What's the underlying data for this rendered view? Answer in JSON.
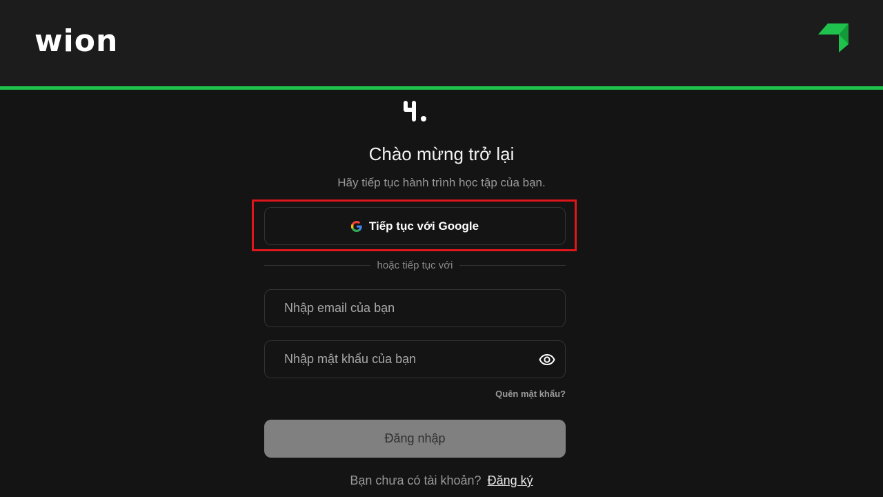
{
  "header": {
    "brand_name": "wion",
    "corner_icon": "green-arrow-icon",
    "accent_color": "#1fc24c"
  },
  "login": {
    "app_icon": "app-logo-icon",
    "title": "Chào mừng trở lại",
    "subtitle": "Hãy tiếp tục hành trình học tập của bạn.",
    "google_button_label": "Tiếp tục với Google",
    "divider_text": "hoặc tiếp tục với",
    "email_placeholder": "Nhập email của bạn",
    "email_value": "",
    "password_placeholder": "Nhập mật khẩu của bạn",
    "password_value": "",
    "forgot_password_label": "Quên mật khẩu?",
    "login_button_label": "Đăng nhập",
    "signup_prompt": "Bạn chưa có tài khoản?",
    "signup_link_label": "Đăng ký"
  },
  "highlight_color": "#e0161b"
}
